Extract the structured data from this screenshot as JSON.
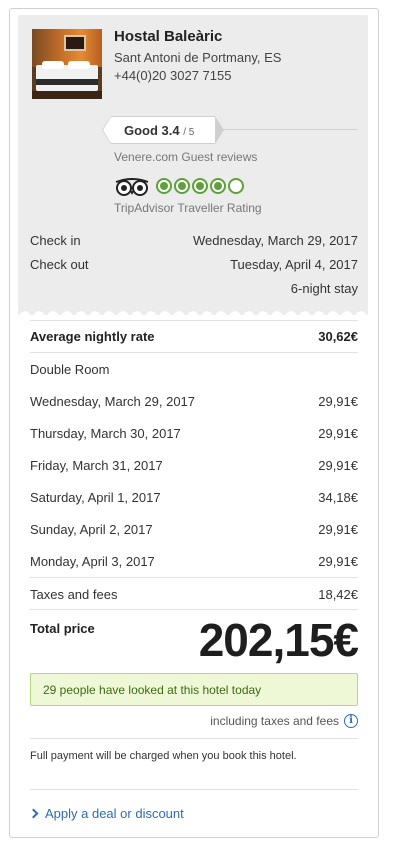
{
  "hotel": {
    "name": "Hostal Baleàric",
    "address": "Sant Antoni de Portmany, ES",
    "phone": "+44(0)20 3027 7155"
  },
  "guest_rating": {
    "label": "Good 3.4",
    "max": "/ 5",
    "source": "Venere.com Guest reviews"
  },
  "tripadvisor": {
    "bubbles_filled": 4,
    "bubbles_total": 5,
    "label": "TripAdvisor Traveller Rating",
    "accent_color": "#5fa03a"
  },
  "stay": {
    "checkin_label": "Check in",
    "checkin_value": "Wednesday, March 29, 2017",
    "checkout_label": "Check out",
    "checkout_value": "Tuesday, April 4, 2017",
    "nights": "6-night stay"
  },
  "pricing": {
    "avg_label": "Average nightly rate",
    "avg_value": "30,62€",
    "room_type": "Double Room",
    "nights": [
      {
        "date": "Wednesday, March 29, 2017",
        "price": "29,91€"
      },
      {
        "date": "Thursday, March 30, 2017",
        "price": "29,91€"
      },
      {
        "date": "Friday, March 31, 2017",
        "price": "29,91€"
      },
      {
        "date": "Saturday, April 1, 2017",
        "price": "34,18€"
      },
      {
        "date": "Sunday, April 2, 2017",
        "price": "29,91€"
      },
      {
        "date": "Monday, April 3, 2017",
        "price": "29,91€"
      }
    ],
    "taxes_label": "Taxes and fees",
    "taxes_value": "18,42€",
    "total_label": "Total price",
    "total_value": "202,15€"
  },
  "notice": "29 people have looked at this hotel today",
  "including_note": "including taxes and fees",
  "payment_note": "Full payment will be charged when you book this hotel.",
  "deal_link": "Apply a deal or discount",
  "colors": {
    "link": "#2d6db5",
    "notice_bg": "#eef8d6",
    "notice_text": "#3d6b14"
  }
}
